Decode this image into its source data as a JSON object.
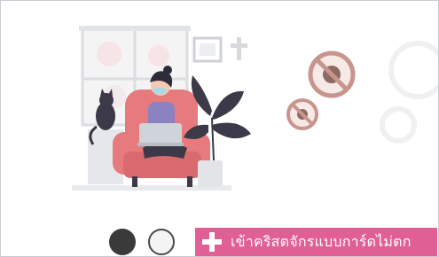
{
  "banner": {
    "text": "เข้าคริสตจักรแบบการ์ดไม่ตก",
    "background": "#e05f95"
  },
  "logos": [
    {
      "icon": "dove-logo-icon",
      "color": "#3a3a3a"
    },
    {
      "icon": "seal-logo-icon",
      "color": "#4a4a4a"
    }
  ],
  "colors": {
    "armchair": "#e77a7d",
    "plant": "#3c3a48",
    "virus": "#c7958d",
    "accent": "#e05f95"
  }
}
